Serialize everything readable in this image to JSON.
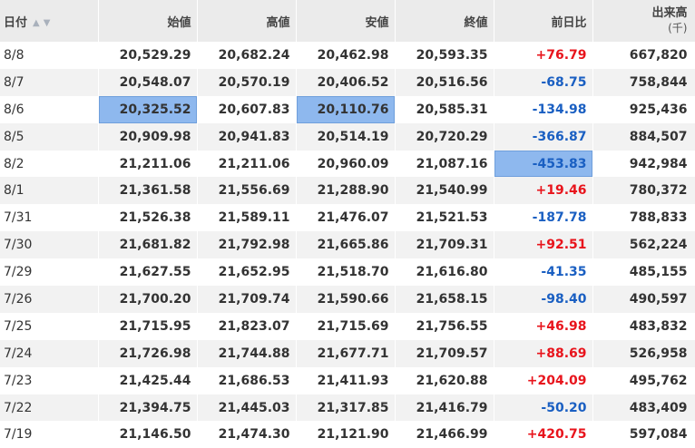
{
  "headers": {
    "date": "日付",
    "open": "始値",
    "high": "高値",
    "low": "安値",
    "close": "終値",
    "change": "前日比",
    "volume": "出来高",
    "volume_unit": "(千)"
  },
  "colors": {
    "positive": "#e8141c",
    "negative": "#1a5fc2",
    "highlight": "#8eb8ee",
    "header_bg": "#ebebeb"
  },
  "rows": [
    {
      "date": "8/8",
      "open": "20,529.29",
      "high": "20,682.24",
      "low": "20,462.98",
      "close": "20,593.35",
      "change": "+76.79",
      "volume": "667,820",
      "dir": "up",
      "hl": []
    },
    {
      "date": "8/7",
      "open": "20,548.07",
      "high": "20,570.19",
      "low": "20,406.52",
      "close": "20,516.56",
      "change": "-68.75",
      "volume": "758,844",
      "dir": "down",
      "hl": []
    },
    {
      "date": "8/6",
      "open": "20,325.52",
      "high": "20,607.83",
      "low": "20,110.76",
      "close": "20,585.31",
      "change": "-134.98",
      "volume": "925,436",
      "dir": "down",
      "hl": [
        "open",
        "low"
      ]
    },
    {
      "date": "8/5",
      "open": "20,909.98",
      "high": "20,941.83",
      "low": "20,514.19",
      "close": "20,720.29",
      "change": "-366.87",
      "volume": "884,507",
      "dir": "down",
      "hl": []
    },
    {
      "date": "8/2",
      "open": "21,211.06",
      "high": "21,211.06",
      "low": "20,960.09",
      "close": "21,087.16",
      "change": "-453.83",
      "volume": "942,984",
      "dir": "down",
      "hl": [
        "change"
      ]
    },
    {
      "date": "8/1",
      "open": "21,361.58",
      "high": "21,556.69",
      "low": "21,288.90",
      "close": "21,540.99",
      "change": "+19.46",
      "volume": "780,372",
      "dir": "up",
      "hl": []
    },
    {
      "date": "7/31",
      "open": "21,526.38",
      "high": "21,589.11",
      "low": "21,476.07",
      "close": "21,521.53",
      "change": "-187.78",
      "volume": "788,833",
      "dir": "down",
      "hl": []
    },
    {
      "date": "7/30",
      "open": "21,681.82",
      "high": "21,792.98",
      "low": "21,665.86",
      "close": "21,709.31",
      "change": "+92.51",
      "volume": "562,224",
      "dir": "up",
      "hl": []
    },
    {
      "date": "7/29",
      "open": "21,627.55",
      "high": "21,652.95",
      "low": "21,518.70",
      "close": "21,616.80",
      "change": "-41.35",
      "volume": "485,155",
      "dir": "down",
      "hl": []
    },
    {
      "date": "7/26",
      "open": "21,700.20",
      "high": "21,709.74",
      "low": "21,590.66",
      "close": "21,658.15",
      "change": "-98.40",
      "volume": "490,597",
      "dir": "down",
      "hl": []
    },
    {
      "date": "7/25",
      "open": "21,715.95",
      "high": "21,823.07",
      "low": "21,715.69",
      "close": "21,756.55",
      "change": "+46.98",
      "volume": "483,832",
      "dir": "up",
      "hl": []
    },
    {
      "date": "7/24",
      "open": "21,726.98",
      "high": "21,744.88",
      "low": "21,677.71",
      "close": "21,709.57",
      "change": "+88.69",
      "volume": "526,958",
      "dir": "up",
      "hl": []
    },
    {
      "date": "7/23",
      "open": "21,425.44",
      "high": "21,686.53",
      "low": "21,411.93",
      "close": "21,620.88",
      "change": "+204.09",
      "volume": "495,762",
      "dir": "up",
      "hl": []
    },
    {
      "date": "7/22",
      "open": "21,394.75",
      "high": "21,445.03",
      "low": "21,317.85",
      "close": "21,416.79",
      "change": "-50.20",
      "volume": "483,409",
      "dir": "down",
      "hl": []
    },
    {
      "date": "7/19",
      "open": "21,146.50",
      "high": "21,474.30",
      "low": "21,121.90",
      "close": "21,466.99",
      "change": "+420.75",
      "volume": "597,084",
      "dir": "up",
      "hl": []
    }
  ]
}
